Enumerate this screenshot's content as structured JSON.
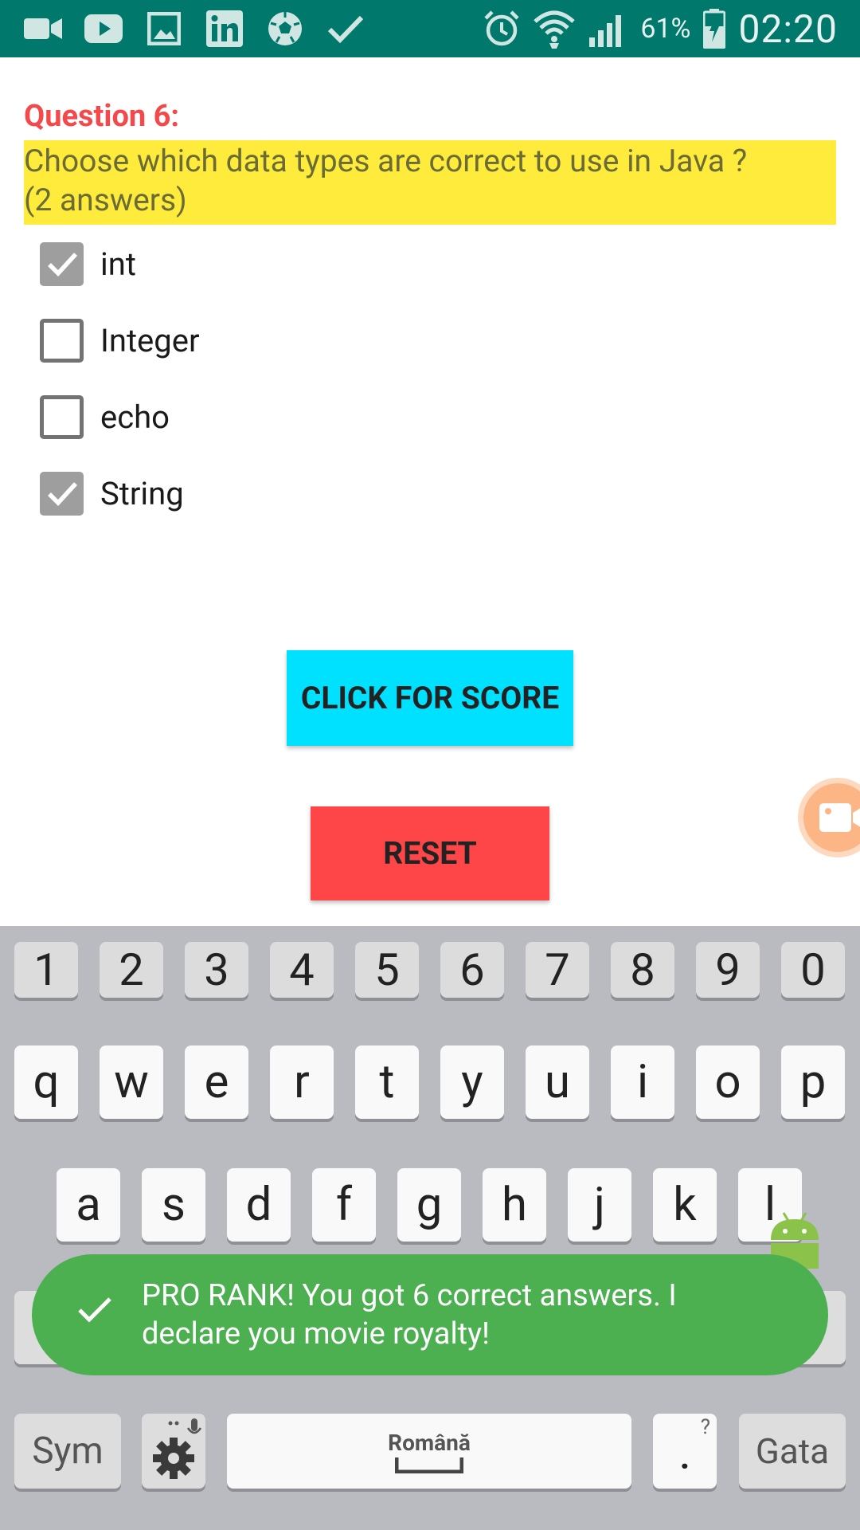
{
  "status_bar": {
    "notification_icons": [
      "video-camera-icon",
      "youtube-icon",
      "gallery-icon",
      "linkedin-icon",
      "soccer-ball-icon",
      "check-icon"
    ],
    "system_icons": [
      "alarm-icon",
      "wifi-icon",
      "signal-icon"
    ],
    "battery_percent": "61%",
    "time": "02:20",
    "background_color": "#00786b"
  },
  "question": {
    "title": "Question 6:",
    "text_line1": "Choose which data types are correct to use in Java ?",
    "text_line2": "(2 answers)",
    "title_color": "#f4494b",
    "highlight_color": "#ffeb3b"
  },
  "options": [
    {
      "label": "int",
      "checked": true
    },
    {
      "label": "Integer",
      "checked": false
    },
    {
      "label": "echo",
      "checked": false
    },
    {
      "label": "String",
      "checked": true
    }
  ],
  "buttons": {
    "score_label": "CLICK FOR SCORE",
    "score_color": "#00e1ff",
    "reset_label": "RESET",
    "reset_color": "#fe4548"
  },
  "floating_icon": "video-record-icon",
  "keyboard": {
    "numbers": [
      "1",
      "2",
      "3",
      "4",
      "5",
      "6",
      "7",
      "8",
      "9",
      "0"
    ],
    "row1": [
      "q",
      "w",
      "e",
      "r",
      "t",
      "y",
      "u",
      "i",
      "o",
      "p"
    ],
    "row2": [
      "a",
      "s",
      "d",
      "f",
      "g",
      "h",
      "j",
      "k",
      "l"
    ],
    "sym_label": "Sym",
    "space_label": "Română",
    "period_label": ".",
    "period_hint": "?",
    "done_label": "Gata"
  },
  "toast": {
    "line1": "PRO RANK! You got 6 correct answers. I",
    "line2": "declare you movie royalty!",
    "color": "#4caf50"
  }
}
